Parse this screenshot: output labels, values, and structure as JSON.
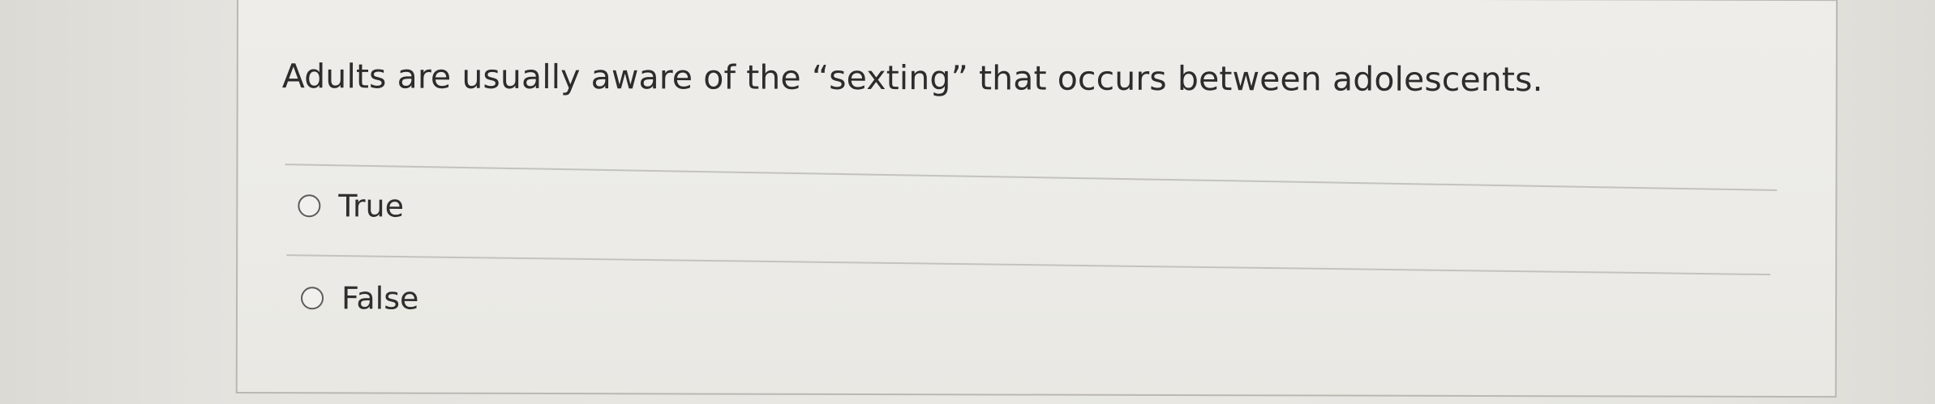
{
  "question": {
    "text": "Adults are usually aware of the “sexting” that occurs between adolescents."
  },
  "options": [
    {
      "label": "True",
      "selected": false
    },
    {
      "label": "False",
      "selected": false
    }
  ],
  "icons": {
    "radio": "radio-circle-icon"
  },
  "colors": {
    "background": "#e7e6e1",
    "card": "#eeede9",
    "text": "#2c2c2c",
    "divider": "#c3c2bd",
    "radio_border": "#5c5c5c"
  }
}
